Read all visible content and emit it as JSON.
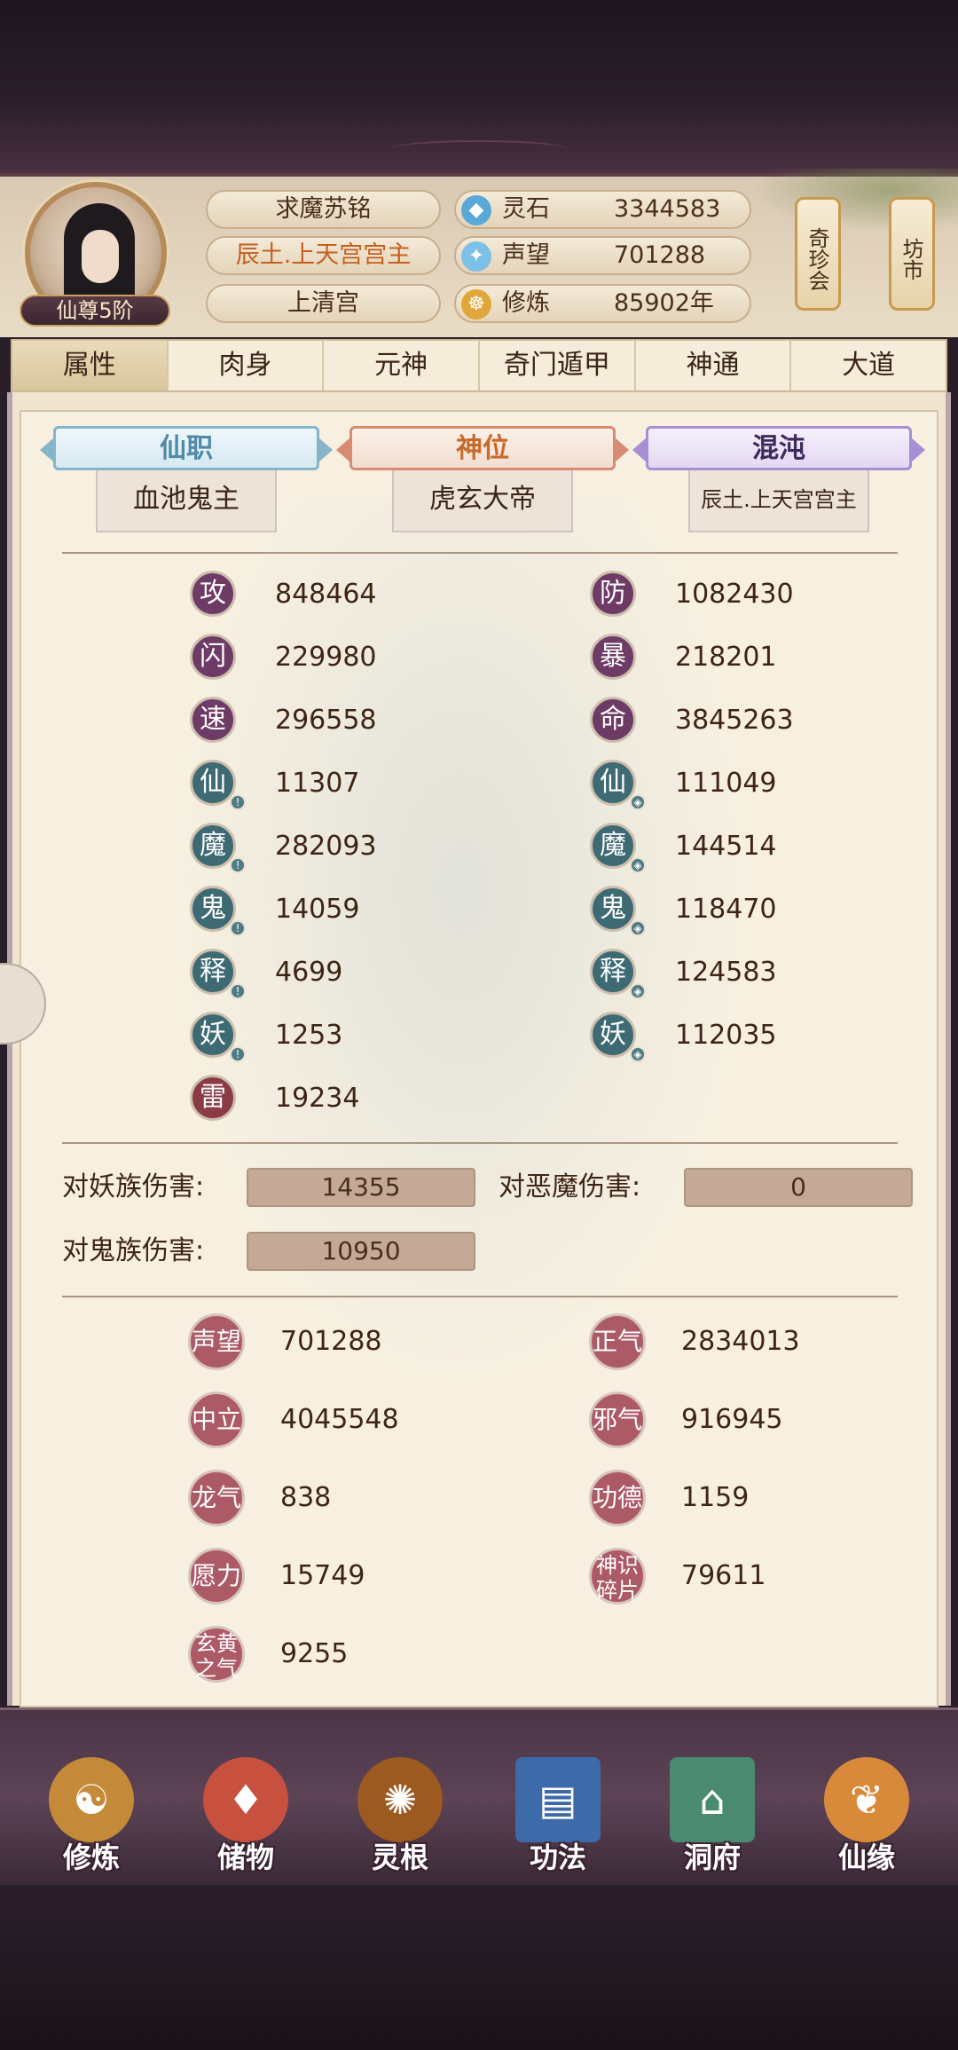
{
  "player": {
    "name": "求魔苏铭",
    "title": "辰土.上天宫宫主",
    "sect": "上清宫",
    "rank": "仙尊5阶"
  },
  "resources": [
    {
      "icon": "spirit-stone-icon",
      "label": "灵石",
      "value": "3344583"
    },
    {
      "icon": "reputation-icon",
      "label": "声望",
      "value": "701288"
    },
    {
      "icon": "cultivation-icon",
      "label": "修炼",
      "value": "85902年"
    }
  ],
  "side_buttons": {
    "treasure": "奇珍会",
    "market": "坊市"
  },
  "tabs": [
    "属性",
    "肉身",
    "元神",
    "奇门遁甲",
    "神通",
    "大道"
  ],
  "titles": [
    {
      "header": "仙职",
      "value": "血池鬼主"
    },
    {
      "header": "神位",
      "value": "虎玄大帝"
    },
    {
      "header": "混沌",
      "value": "辰土.上天宫宫主"
    }
  ],
  "stats_left": [
    {
      "glyph": "攻",
      "value": "848464"
    },
    {
      "glyph": "闪",
      "value": "229980"
    },
    {
      "glyph": "速",
      "value": "296558"
    },
    {
      "glyph": "仙",
      "value": "11307"
    },
    {
      "glyph": "魔",
      "value": "282093"
    },
    {
      "glyph": "鬼",
      "value": "14059"
    },
    {
      "glyph": "释",
      "value": "4699"
    },
    {
      "glyph": "妖",
      "value": "1253"
    },
    {
      "glyph": "雷",
      "value": "19234"
    }
  ],
  "stats_right": [
    {
      "glyph": "防",
      "value": "1082430"
    },
    {
      "glyph": "暴",
      "value": "218201"
    },
    {
      "glyph": "命",
      "value": "3845263"
    },
    {
      "glyph": "仙",
      "value": "111049"
    },
    {
      "glyph": "魔",
      "value": "144514"
    },
    {
      "glyph": "鬼",
      "value": "118470"
    },
    {
      "glyph": "释",
      "value": "124583"
    },
    {
      "glyph": "妖",
      "value": "112035"
    }
  ],
  "damage": {
    "vs_demon_race_label": "对妖族伤害:",
    "vs_demon_race_value": "14355",
    "vs_evil_label": "对恶魔伤害:",
    "vs_evil_value": "0",
    "vs_ghost_label": "对鬼族伤害:",
    "vs_ghost_value": "10950"
  },
  "reputation_left": [
    {
      "glyph": "声望",
      "value": "701288"
    },
    {
      "glyph": "中立",
      "value": "4045548"
    },
    {
      "glyph": "龙气",
      "value": "838"
    },
    {
      "glyph": "愿力",
      "value": "15749"
    },
    {
      "glyph": "玄黄之气",
      "value": "9255"
    }
  ],
  "reputation_right": [
    {
      "glyph": "正气",
      "value": "2834013"
    },
    {
      "glyph": "邪气",
      "value": "916945"
    },
    {
      "glyph": "功德",
      "value": "1159"
    },
    {
      "glyph": "神识碎片",
      "value": "79611"
    }
  ],
  "bottom_nav": [
    {
      "label": "修炼",
      "icon": "meditation-icon",
      "glyph": "☯"
    },
    {
      "label": "储物",
      "icon": "storage-bag-icon",
      "glyph": "♦"
    },
    {
      "label": "灵根",
      "icon": "spirit-root-icon",
      "glyph": "✺"
    },
    {
      "label": "功法",
      "icon": "manual-book-icon",
      "glyph": "▤"
    },
    {
      "label": "洞府",
      "icon": "cave-mansion-icon",
      "glyph": "⌂"
    },
    {
      "label": "仙缘",
      "icon": "gourd-icon",
      "glyph": "❦"
    }
  ],
  "colors": {
    "accent_purple": "#6e3a66",
    "accent_teal": "#3e6a74",
    "accent_red": "#8a3b46",
    "panel_bg": "#f7f0e1"
  }
}
